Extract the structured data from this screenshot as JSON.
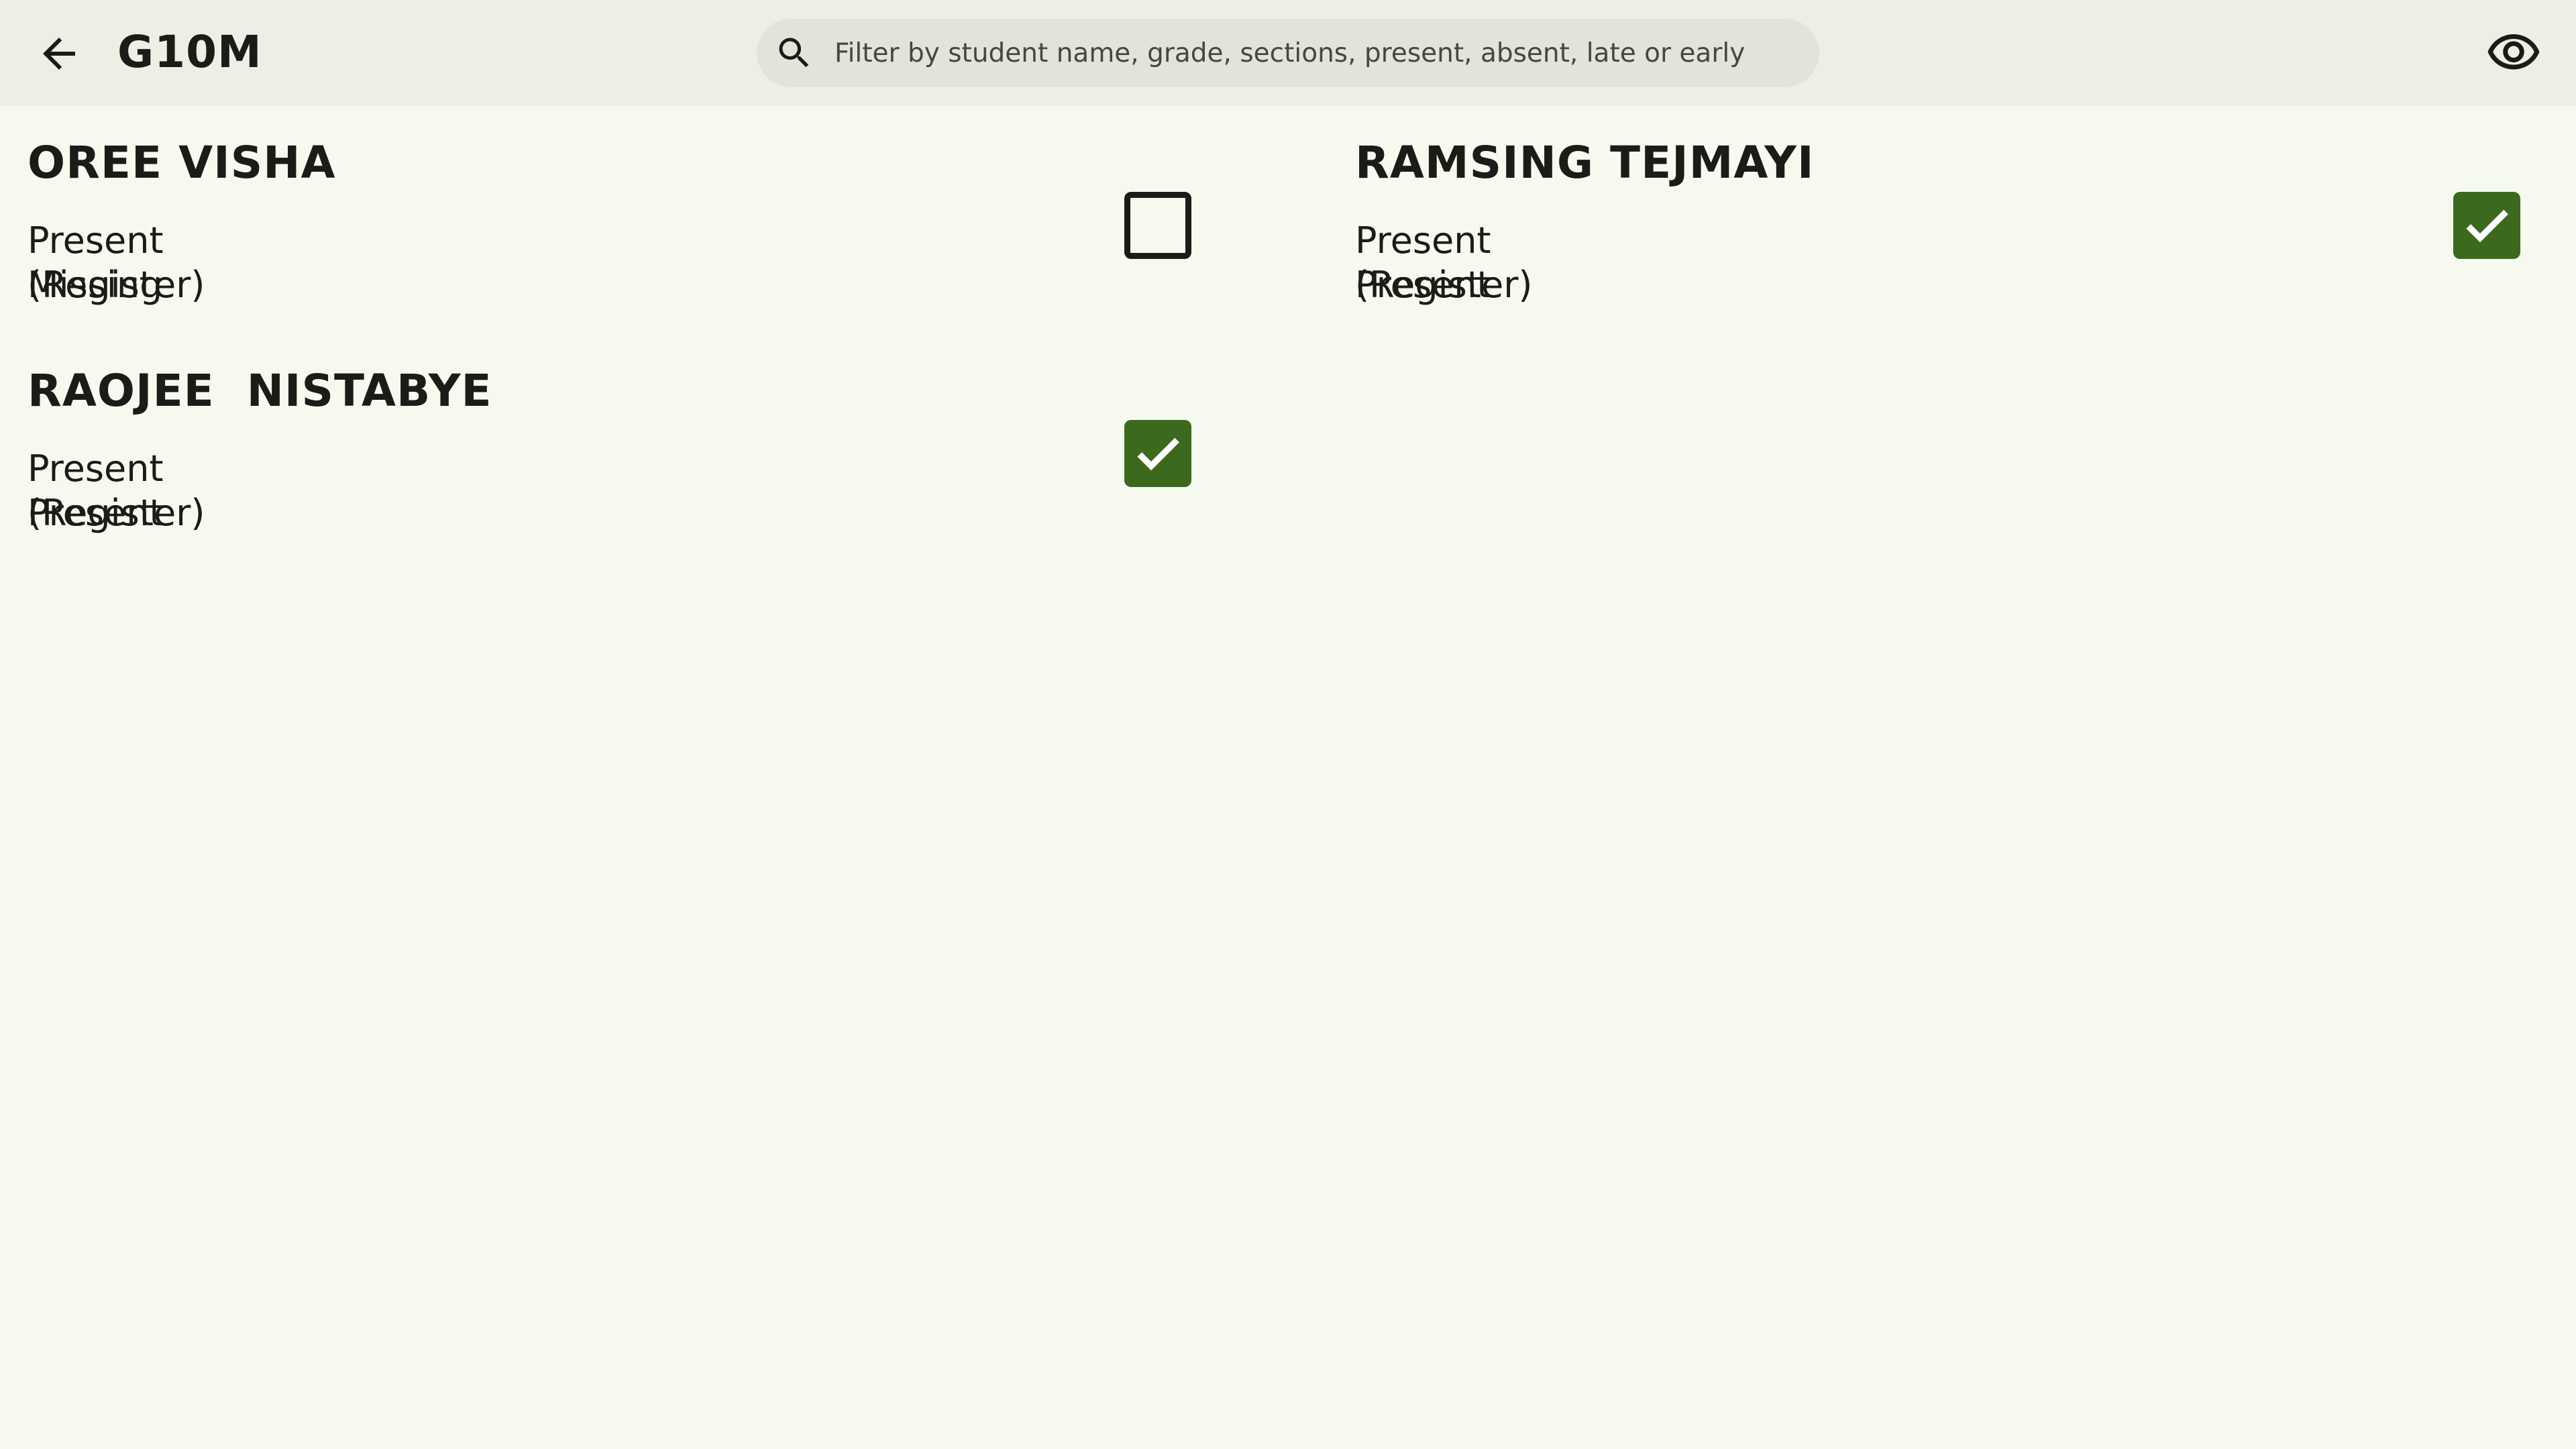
{
  "header": {
    "title": "G10M",
    "back_icon": "arrow-back-icon",
    "visibility_icon": "eye-icon"
  },
  "search": {
    "placeholder": "Filter by student name, grade, sections, present, absent, late or early",
    "value": "",
    "icon": "search-icon"
  },
  "students": [
    {
      "name": "OREE VISHA",
      "line1": "Present (Register)",
      "line2": "Missing",
      "checked": false
    },
    {
      "name": "RAMSING TEJMAYI",
      "line1": "Present (Register)",
      "line2": "Present",
      "checked": true
    },
    {
      "name": "RAOJEE  NISTABYE",
      "line1": "Present (Register)",
      "line2": "Present",
      "checked": true
    }
  ],
  "colors": {
    "background": "#f6faee",
    "appbar": "#ecefe3",
    "search_bg": "#e1e4d8",
    "checkbox_checked": "#3b6a1f",
    "text": "#1a1c18"
  }
}
